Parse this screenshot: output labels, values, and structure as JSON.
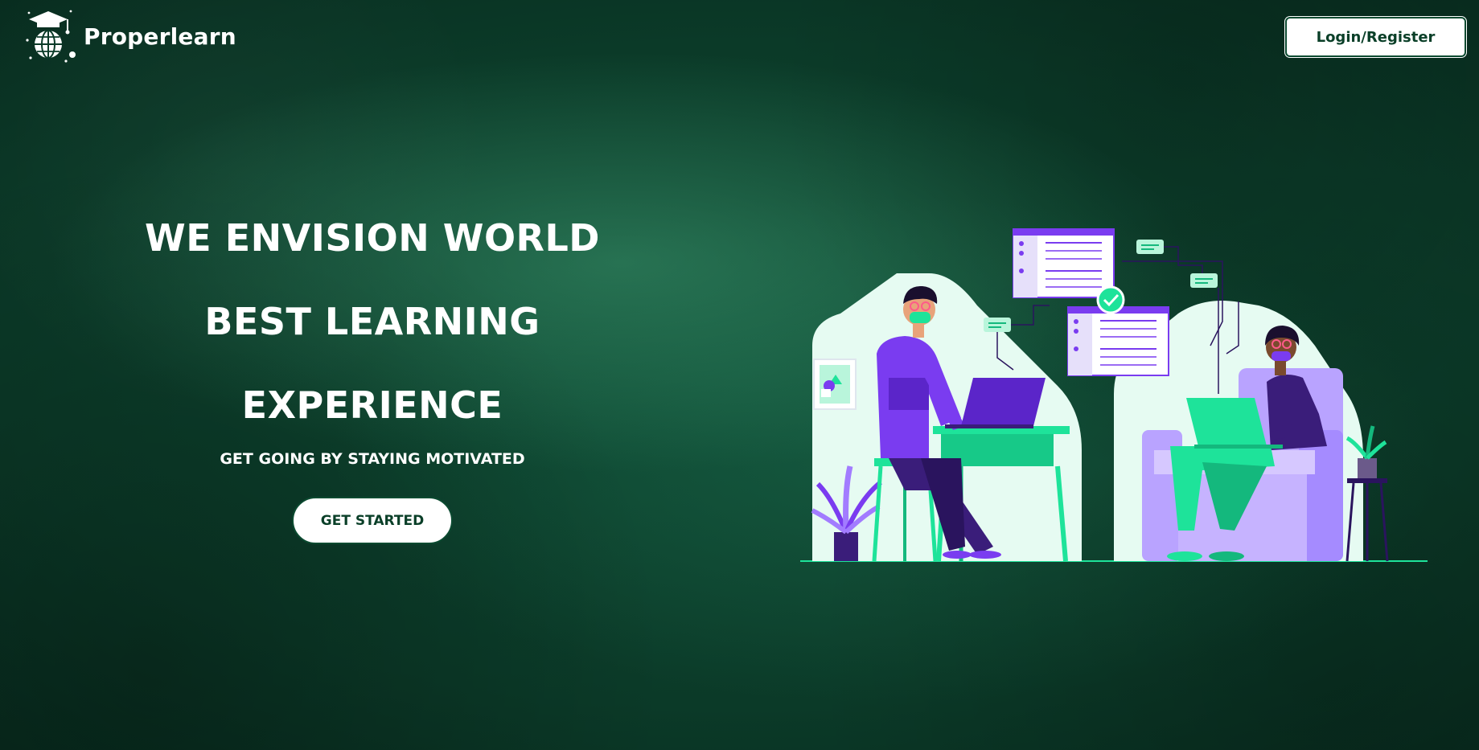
{
  "header": {
    "brand_name": "Properlearn",
    "logo_icon": "graduation-cap-globe-icon",
    "login_label": "Login/Register"
  },
  "hero": {
    "headline_lines": [
      "WE ENVISION WORLD",
      "BEST LEARNING",
      "EXPERIENCE"
    ],
    "tagline": "GET GOING BY STAYING MOTIVATED",
    "cta_label": "GET STARTED"
  },
  "illustration": {
    "subject": "people-working-on-laptops-illustration"
  },
  "colors": {
    "background": "#0b3a28",
    "accent_green": "#1ee39a",
    "accent_purple": "#7a3cf0",
    "button_text": "#0a3f28",
    "text": "#ffffff"
  }
}
